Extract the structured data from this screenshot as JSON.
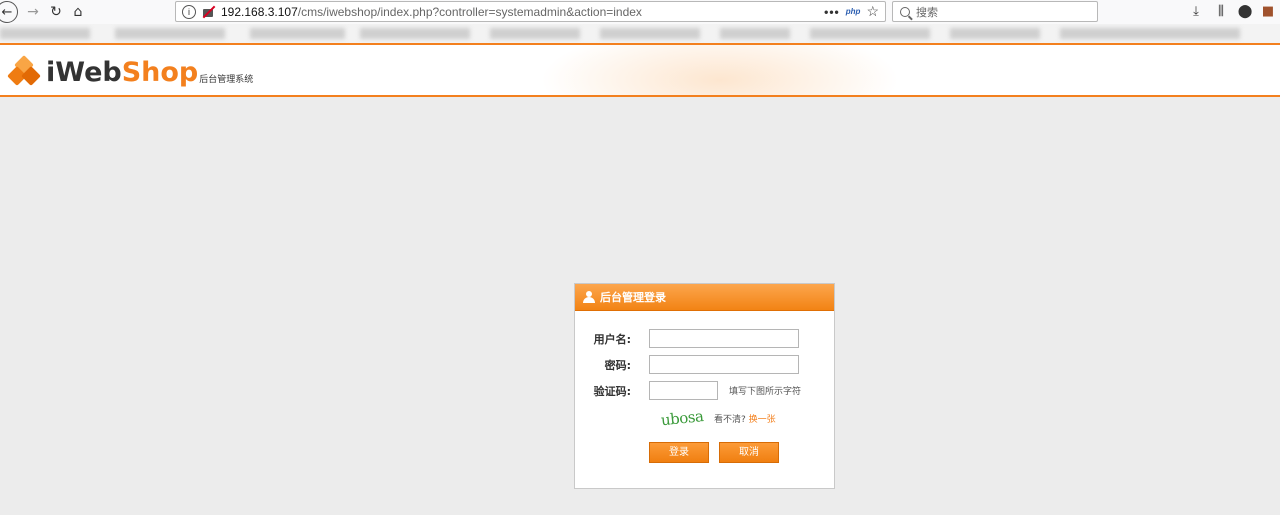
{
  "browser": {
    "url_host": "192.168.3.107",
    "url_path": "/cms/iwebshop/index.php?controller=systemadmin&action=index",
    "url_more": "•••",
    "url_php_badge": "php",
    "search_placeholder": "搜索"
  },
  "header": {
    "logo_iweb": "iWeb",
    "logo_shop": "Shop",
    "logo_subtitle": "后台管理系统",
    "accent_color": "#f3801e"
  },
  "login": {
    "title": "后台管理登录",
    "username_label": "用户名:",
    "username_value": "",
    "password_label": "密码:",
    "password_value": "",
    "captcha_label": "验证码:",
    "captcha_value": "",
    "captcha_hint": "填写下图所示字符",
    "captcha_image_text": "ubosa",
    "refresh_prefix": "看不清?",
    "refresh_link": "换一张",
    "login_button": "登录",
    "cancel_button": "取消"
  },
  "icons": {
    "back": "back-arrow-icon",
    "forward": "forward-arrow-icon",
    "reload": "reload-icon",
    "home": "home-icon",
    "download": "download-icon",
    "library": "library-icon",
    "pocket": "pocket-icon"
  }
}
